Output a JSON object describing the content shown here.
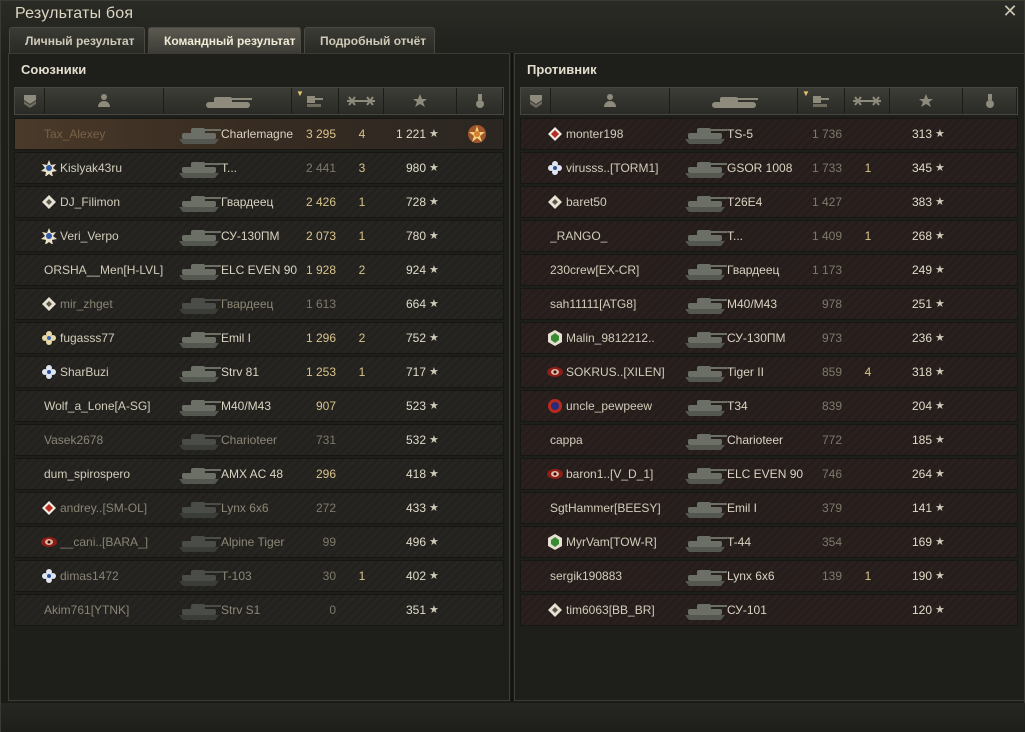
{
  "window": {
    "title": "Результаты боя"
  },
  "tabs": [
    {
      "label": "Личный результат",
      "active": false
    },
    {
      "label": "Командный результат",
      "active": true
    },
    {
      "label": "Подробный отчёт",
      "active": false
    }
  ],
  "allies": {
    "title": "Союзники",
    "rows": [
      {
        "player": "Tax_Alexey",
        "tank": "Charlemagne",
        "damage": "3 295",
        "kills": "4",
        "xp": "1 221",
        "me": true,
        "rank": "none",
        "medal": true
      },
      {
        "player": "Kislyak43ru",
        "tank": "T...",
        "damage": "2 441",
        "kills": "3",
        "xp": "980",
        "rank": "gold-star",
        "damageDim": true
      },
      {
        "player": "DJ_Filimon",
        "tank": "Гвардеец",
        "damage": "2 426",
        "kills": "1",
        "xp": "728",
        "rank": "diamond-white"
      },
      {
        "player": "Veri_Verpo",
        "tank": "СУ-130ПМ",
        "damage": "2 073",
        "kills": "1",
        "xp": "780",
        "rank": "gold-star"
      },
      {
        "player": "ORSHA__Men[H-LVL]",
        "tank": "ELC EVEN 90",
        "damage": "1 928",
        "kills": "2",
        "xp": "924",
        "rank": "none"
      },
      {
        "player": "mir_zhget",
        "tank": "Гвардеец",
        "damage": "1 613",
        "kills": "",
        "xp": "664",
        "rank": "diamond-white",
        "dim": true
      },
      {
        "player": "fugasss77",
        "tank": "Emil I",
        "damage": "1 296",
        "kills": "2",
        "xp": "752",
        "rank": "flower"
      },
      {
        "player": "SharBuzi",
        "tank": "Strv 81",
        "damage": "1 253",
        "kills": "1",
        "xp": "717",
        "rank": "flower-blue"
      },
      {
        "player": "Wolf_a_Lone[A-SG]",
        "tank": "M40/M43",
        "damage": "907",
        "kills": "",
        "xp": "523",
        "rank": "none"
      },
      {
        "player": "Vasek2678",
        "tank": "Charioteer",
        "damage": "731",
        "kills": "",
        "xp": "532",
        "rank": "none",
        "dim": true
      },
      {
        "player": "dum_spirospero",
        "tank": "AMX AC 48",
        "damage": "296",
        "kills": "",
        "xp": "418",
        "rank": "none"
      },
      {
        "player": "andrey..[SM-OL]",
        "tank": "Lynx 6x6",
        "damage": "272",
        "kills": "",
        "xp": "433",
        "rank": "diamond-red",
        "dim": true
      },
      {
        "player": "__cani..[BARA_]",
        "tank": "Alpine Tiger",
        "damage": "99",
        "kills": "",
        "xp": "496",
        "rank": "eye-red",
        "dim": true
      },
      {
        "player": "dimas1472",
        "tank": "T-103",
        "damage": "30",
        "kills": "1",
        "xp": "402",
        "rank": "flower-blue",
        "dim": true
      },
      {
        "player": "Akim761[YTNK]",
        "tank": "Strv S1",
        "damage": "0",
        "kills": "",
        "xp": "351",
        "rank": "none",
        "dim": true
      }
    ]
  },
  "enemies": {
    "title": "Противник",
    "rows": [
      {
        "player": "monter198",
        "tank": "TS-5",
        "damage": "1 736",
        "kills": "",
        "xp": "313",
        "rank": "diamond-red"
      },
      {
        "player": "virusss..[TORM1]",
        "tank": "GSOR 1008",
        "damage": "1 733",
        "kills": "1",
        "xp": "345",
        "rank": "flower-blue"
      },
      {
        "player": "baret50",
        "tank": "T26E4",
        "damage": "1 427",
        "kills": "",
        "xp": "383",
        "rank": "diamond-white"
      },
      {
        "player": "_RANGO_",
        "tank": "T...",
        "damage": "1 409",
        "kills": "1",
        "xp": "268",
        "rank": "none"
      },
      {
        "player": "230crew[EX-CR]",
        "tank": "Гвардеец",
        "damage": "1 173",
        "kills": "",
        "xp": "249",
        "rank": "none"
      },
      {
        "player": "sah11111[ATG8]",
        "tank": "M40/M43",
        "damage": "978",
        "kills": "",
        "xp": "251",
        "rank": "none"
      },
      {
        "player": "Malin_9812212..",
        "tank": "СУ-130ПМ",
        "damage": "973",
        "kills": "",
        "xp": "236",
        "rank": "hex-green"
      },
      {
        "player": "SOKRUS..[XILEN]",
        "tank": "Tiger II",
        "damage": "859",
        "kills": "4",
        "xp": "318",
        "rank": "eye-red"
      },
      {
        "player": "uncle_pewpeew",
        "tank": "T34",
        "damage": "839",
        "kills": "",
        "xp": "204",
        "rank": "circle-red"
      },
      {
        "player": "cappa",
        "tank": "Charioteer",
        "damage": "772",
        "kills": "",
        "xp": "185",
        "rank": "none"
      },
      {
        "player": "baron1..[V_D_1]",
        "tank": "ELC EVEN 90",
        "damage": "746",
        "kills": "",
        "xp": "264",
        "rank": "eye-red"
      },
      {
        "player": "SgtHammer[BEESY]",
        "tank": "Emil I",
        "damage": "379",
        "kills": "",
        "xp": "141",
        "rank": "none"
      },
      {
        "player": "MyrVam[TOW-R]",
        "tank": "T-44",
        "damage": "354",
        "kills": "",
        "xp": "169",
        "rank": "hex-green"
      },
      {
        "player": "sergik190883",
        "tank": "Lynx 6x6",
        "damage": "139",
        "kills": "1",
        "xp": "190",
        "rank": "none"
      },
      {
        "player": "tim6063[BB_BR]",
        "tank": "СУ-101",
        "damage": "",
        "kills": "",
        "xp": "120",
        "rank": "diamond-white"
      }
    ]
  },
  "colors": {
    "accent": "#d9c48c",
    "enemy_bg": "#2a211f",
    "me_bg": "#4a3a2a"
  }
}
